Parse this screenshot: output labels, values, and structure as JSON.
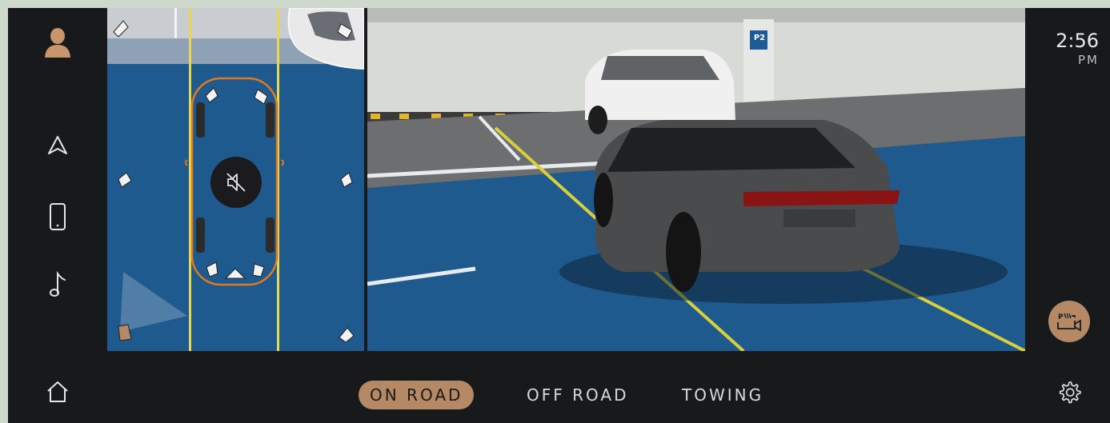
{
  "clock": {
    "time": "2:56",
    "ampm": "PM"
  },
  "sidebar": {
    "items": [
      {
        "icon": "profile-icon"
      },
      {
        "icon": "navigation-icon"
      },
      {
        "icon": "phone-icon"
      },
      {
        "icon": "music-icon"
      },
      {
        "icon": "home-icon"
      }
    ]
  },
  "camera": {
    "parking_sign": "P2",
    "mute_icon": "speaker-muted-icon",
    "parking_camera_icon": "parking-camera-icon",
    "settings_icon": "gear-icon"
  },
  "modes": [
    {
      "label": "ON ROAD",
      "active": true
    },
    {
      "label": "OFF ROAD",
      "active": false
    },
    {
      "label": "TOWING",
      "active": false
    }
  ],
  "colors": {
    "accent": "#b58866",
    "background": "#17191b",
    "floor_blue": "#1f5a8f",
    "guide_yellow": "#e8d84a",
    "car_outline": "#e07a1e"
  }
}
